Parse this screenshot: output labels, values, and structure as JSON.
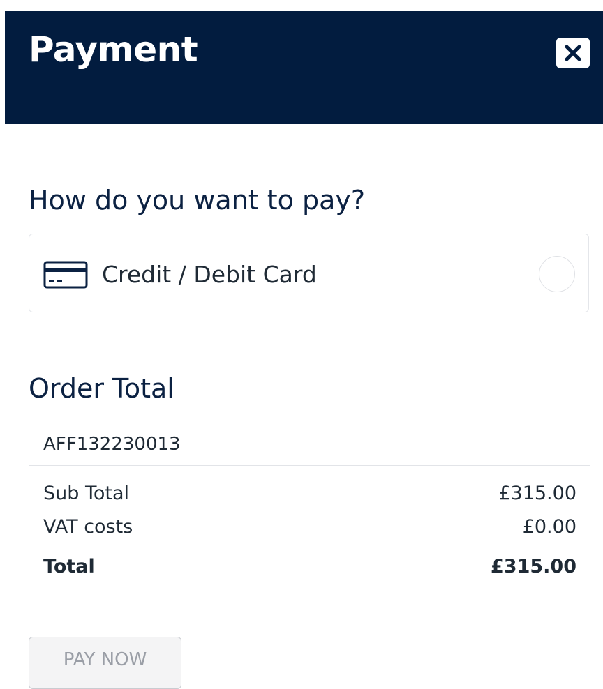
{
  "header": {
    "title": "Payment",
    "close_icon": "close-icon",
    "background_color": "#021c3f"
  },
  "payment_method": {
    "heading": "How do you want to pay?",
    "options": [
      {
        "label": "Credit / Debit Card",
        "icon": "credit-card-icon",
        "selected": false
      }
    ]
  },
  "order": {
    "heading": "Order Total",
    "reference": "AFF132230013",
    "rows": [
      {
        "label": "Sub Total",
        "value": "£315.00",
        "bold": false
      },
      {
        "label": "VAT costs",
        "value": "£0.00",
        "bold": false
      },
      {
        "label": "Total",
        "value": "£315.00",
        "bold": true
      }
    ]
  },
  "actions": {
    "pay_label": "PAY NOW",
    "pay_disabled": true
  },
  "colors": {
    "primary": "#021c3f",
    "text": "#1f2a35",
    "border": "#e4e6ea",
    "disabled_text": "#9a9ea6"
  }
}
